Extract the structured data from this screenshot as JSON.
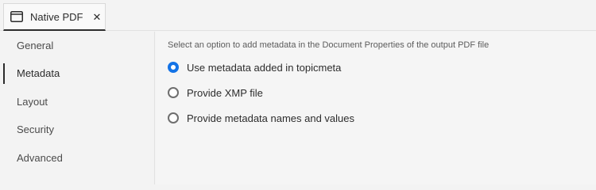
{
  "tab": {
    "label": "Native PDF",
    "close_glyph": "✕",
    "icon": "window-icon"
  },
  "sidebar": {
    "items": [
      {
        "label": "General",
        "active": false
      },
      {
        "label": "Metadata",
        "active": true
      },
      {
        "label": "Layout",
        "active": false
      },
      {
        "label": "Security",
        "active": false
      },
      {
        "label": "Advanced",
        "active": false
      }
    ]
  },
  "main": {
    "hint": "Select an option to add metadata in the Document Properties of the output PDF file",
    "options": [
      {
        "label": "Use metadata added in topicmeta",
        "selected": true
      },
      {
        "label": "Provide XMP file",
        "selected": false
      },
      {
        "label": "Provide metadata names and values",
        "selected": false
      }
    ]
  },
  "colors": {
    "accent": "#1473e6",
    "text": "#2c2c2c"
  }
}
